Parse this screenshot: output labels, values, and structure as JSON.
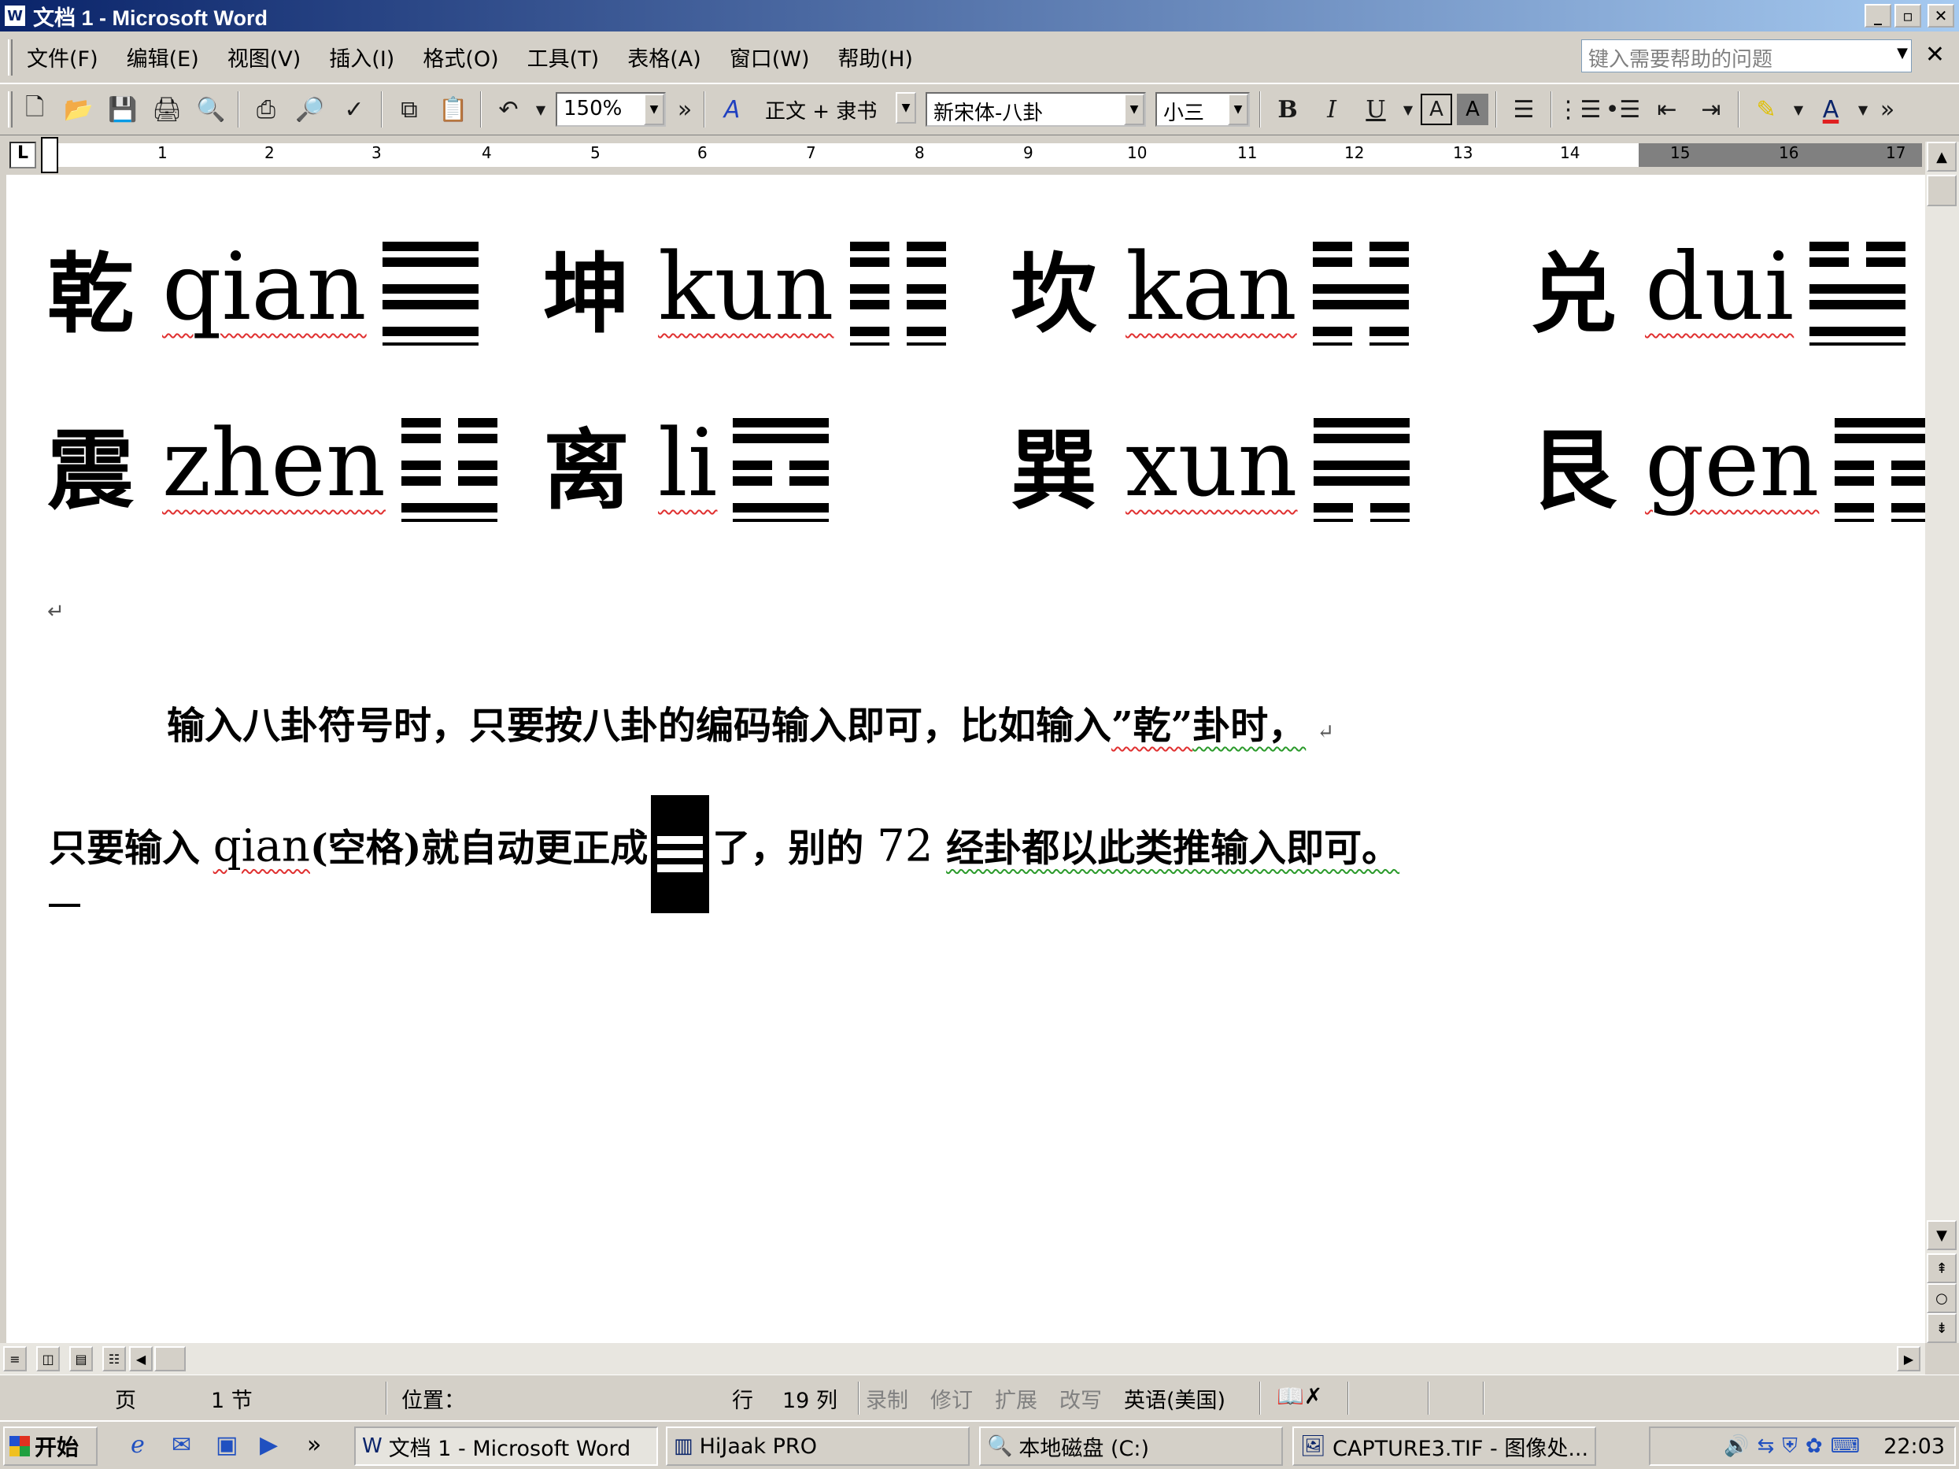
{
  "window": {
    "title": "文档 1 - Microsoft Word",
    "icon": "word-doc-icon",
    "min": "_",
    "max": "▫",
    "close": "✕"
  },
  "menu": {
    "items": [
      "文件(F)",
      "编辑(E)",
      "视图(V)",
      "插入(I)",
      "格式(O)",
      "工具(T)",
      "表格(A)",
      "窗口(W)",
      "帮助(H)"
    ],
    "help_placeholder": "键入需要帮助的问题",
    "close": "✕"
  },
  "toolbar": {
    "zoom": "150%",
    "more": "»",
    "style": "正文 + 隶书",
    "font": "新宋体-八卦",
    "size": "小三",
    "bold": "B",
    "italic": "I",
    "underline": "U"
  },
  "ruler": {
    "tab_selector": "L",
    "numbers": [
      "1",
      "2",
      "3",
      "4",
      "5",
      "6",
      "7",
      "8",
      "9",
      "10",
      "11",
      "12",
      "13",
      "14",
      "15",
      "16",
      "17"
    ]
  },
  "document": {
    "trigrams_row1": [
      {
        "char": "乾",
        "pinyin": "qian",
        "lines": [
          "solid",
          "solid",
          "solid"
        ]
      },
      {
        "char": "坤",
        "pinyin": "kun",
        "lines": [
          "broken",
          "broken",
          "broken"
        ]
      },
      {
        "char": "坎",
        "pinyin": "kan",
        "lines": [
          "broken",
          "solid",
          "broken"
        ]
      },
      {
        "char": "兑",
        "pinyin": "dui",
        "lines": [
          "broken",
          "solid",
          "solid"
        ]
      }
    ],
    "trigrams_row2": [
      {
        "char": "震",
        "pinyin": "zhen",
        "lines": [
          "broken",
          "broken",
          "solid"
        ]
      },
      {
        "char": "离",
        "pinyin": "li",
        "lines": [
          "solid",
          "broken",
          "solid"
        ]
      },
      {
        "char": "巽",
        "pinyin": "xun",
        "lines": [
          "solid",
          "solid",
          "broken"
        ]
      },
      {
        "char": "艮",
        "pinyin": "gen",
        "lines": [
          "solid",
          "broken",
          "broken"
        ]
      }
    ],
    "pilcrow": "↵",
    "para1_a": "输入八卦符号时，只要按八卦的编码输入即可，比如输入",
    "para1_b": "”乾”",
    "para1_c": "卦时，",
    "para2_a": "只要输入",
    "para2_b": "qian",
    "para2_c": "(空格)就自动更正成",
    "para2_d": "了，别的",
    "para2_e": "72",
    "para2_f": "经卦都以此类推输入即可。"
  },
  "status": {
    "page": "页",
    "section": "1 节",
    "position": "位置：",
    "line": "行",
    "col": "19 列",
    "rec": "录制",
    "trk": "修订",
    "ext": "扩展",
    "ovr": "改写",
    "lang": "英语(美国)"
  },
  "taskbar": {
    "start": "开始",
    "tasks": [
      "文档 1 - Microsoft Word",
      "HiJaak PRO",
      "本地磁盘 (C:)",
      "CAPTURE3.TIF - 图像处..."
    ],
    "clock": "22:03"
  }
}
